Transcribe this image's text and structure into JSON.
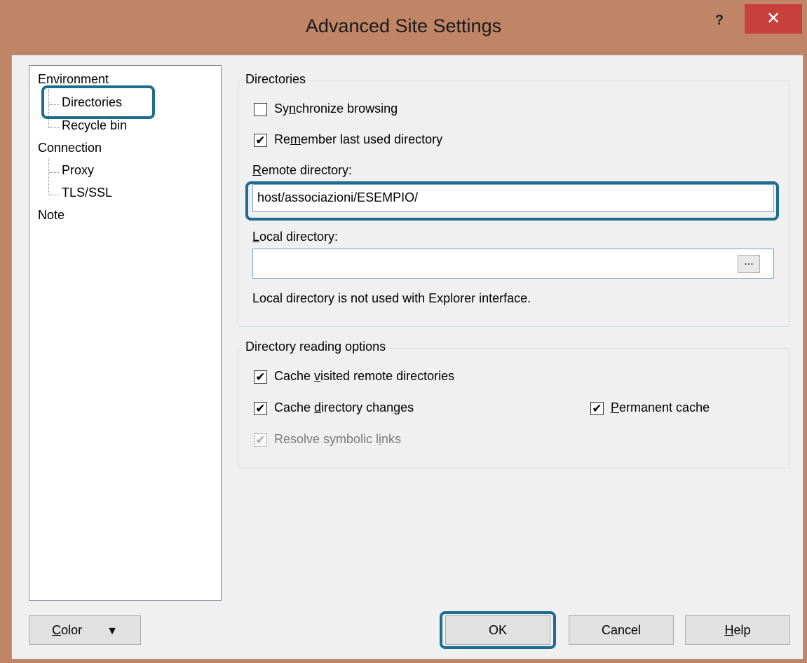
{
  "window": {
    "title": "Advanced Site Settings",
    "help_label": "?",
    "close_label": "✕"
  },
  "tree": {
    "environment": "Environment",
    "directories": "Directories",
    "recycle_bin": "Recycle bin",
    "connection": "Connection",
    "proxy": "Proxy",
    "tls_ssl": "TLS/SSL",
    "note": "Note"
  },
  "directories_group": {
    "title": "Directories",
    "sync_browsing": {
      "label_pre": "Sy",
      "label_ul": "n",
      "label_post": "chronize browsing",
      "checked": false
    },
    "remember_last": {
      "label_pre": "Re",
      "label_ul": "m",
      "label_post": "ember last used directory",
      "checked": true
    },
    "remote_label_ul": "R",
    "remote_label_rest": "emote directory:",
    "remote_value": "host/associazioni/ESEMPIO/",
    "local_label_ul": "L",
    "local_label_rest": "ocal directory:",
    "local_value": "",
    "browse_label": "...",
    "note": "Local directory is not used with Explorer interface."
  },
  "reading_group": {
    "title": "Directory reading options",
    "cache_visited": {
      "label_pre": "Cache ",
      "label_ul": "v",
      "label_post": "isited remote directories",
      "checked": true
    },
    "cache_changes": {
      "label_pre": "Cache ",
      "label_ul": "d",
      "label_post": "irectory changes",
      "checked": true
    },
    "permanent_cache": {
      "label_pre": "",
      "label_ul": "P",
      "label_post": "ermanent cache",
      "checked": true
    },
    "resolve_links": {
      "label_pre": "Resolve symbolic l",
      "label_ul": "i",
      "label_post": "nks",
      "checked": true,
      "disabled": true
    }
  },
  "buttons": {
    "color_ul": "C",
    "color_rest": "olor",
    "color_arrow": "▼",
    "ok": "OK",
    "cancel": "Cancel",
    "help_ul": "H",
    "help_rest": "elp"
  },
  "colors": {
    "title_bar": "#c08466",
    "close_button": "#c7403b",
    "highlight": "#1e6d8e"
  }
}
